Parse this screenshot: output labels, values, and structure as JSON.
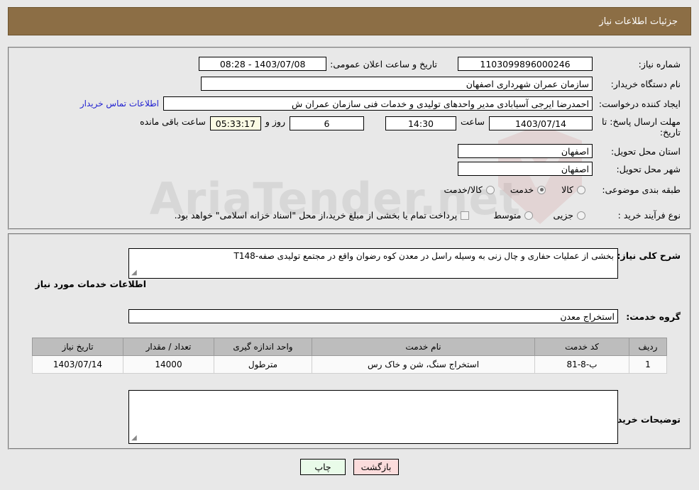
{
  "header": {
    "title": "جزئیات اطلاعات نیاز",
    "bg_color": "#8c6e45",
    "text_color": "#ffffff"
  },
  "watermark": {
    "text": "AriaTender.net"
  },
  "need_info": {
    "need_number_label": "شماره نیاز:",
    "need_number_value": "1103099896000246",
    "announce_datetime_label": "تاریخ و ساعت اعلان عمومی:",
    "announce_datetime_value": "1403/07/08 - 08:28",
    "buyer_org_label": "نام دستگاه خریدار:",
    "buyer_org_value": "سازمان عمران شهرداری اصفهان",
    "requester_label": "ایجاد کننده درخواست:",
    "requester_value": "احمدرضا ایرجی آسیابادی مدیر واحدهای تولیدی و خدمات فنی سازمان عمران ش",
    "contact_link": "اطلاعات تماس خریدار",
    "deadline_label": "مهلت ارسال پاسخ: تا تاریخ:",
    "deadline_date": "1403/07/14",
    "deadline_hour_label": "ساعت",
    "deadline_hour_value": "14:30",
    "days_remaining_value": "6",
    "days_and_label": "روز و",
    "countdown_value": "05:33:17",
    "remaining_label": "ساعت باقی مانده",
    "province_label": "استان محل تحویل:",
    "province_value": "اصفهان",
    "city_label": "شهر محل تحویل:",
    "city_value": "اصفهان",
    "category_label": "طبقه بندی موضوعی:",
    "category_options": [
      {
        "label": "کالا",
        "selected": false
      },
      {
        "label": "خدمت",
        "selected": true
      },
      {
        "label": "کالا/خدمت",
        "selected": false
      }
    ],
    "process_label": "نوع فرآیند خرید :",
    "process_options": [
      {
        "label": "جزیی",
        "selected": false
      },
      {
        "label": "متوسط",
        "selected": false
      }
    ],
    "treasury_checkbox_label": "پرداخت تمام یا بخشی از مبلغ خرید،از محل \"اسناد خزانه اسلامی\" خواهد بود.",
    "treasury_checked": false
  },
  "need_desc": {
    "label": "شرح کلی نیاز:",
    "value": "بخشی از عملیات حفاری و چال زنی به وسیله راسل در معدن کوه رضوان واقع در مجتمع تولیدی صفه-T148"
  },
  "services": {
    "section_title": "اطلاعات خدمات مورد نیاز",
    "group_label": "گروه خدمت:",
    "group_value": "استخراج معدن",
    "table": {
      "columns": [
        "ردیف",
        "کد خدمت",
        "نام خدمت",
        "واحد اندازه گیری",
        "تعداد / مقدار",
        "تاریخ نیاز"
      ],
      "rows": [
        {
          "row_no": "1",
          "service_code": "ب-8-81",
          "service_name": "استخراج سنگ، شن و خاک رس",
          "unit": "مترطول",
          "quantity": "14000",
          "need_date": "1403/07/14"
        }
      ]
    }
  },
  "buyer_notes": {
    "label": "توضیحات خریدار;",
    "value": ""
  },
  "buttons": {
    "print": "چاپ",
    "back": "بازگشت"
  }
}
